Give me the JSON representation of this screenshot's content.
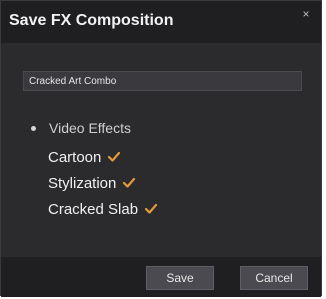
{
  "dialog": {
    "title": "Save FX Composition",
    "close_symbol": "×"
  },
  "name_field": {
    "value": "Cracked Art Combo"
  },
  "tree": {
    "root_label": "Video Effects",
    "items": [
      {
        "label": "Cartoon",
        "checked": true
      },
      {
        "label": "Stylization",
        "checked": true
      },
      {
        "label": "Cracked Slab",
        "checked": true
      }
    ]
  },
  "buttons": {
    "save_label": "Save",
    "cancel_label": "Cancel"
  },
  "colors": {
    "background": "#2b2b2e",
    "titlebar": "#1f1f22",
    "checkmark": "#e39a3b"
  }
}
